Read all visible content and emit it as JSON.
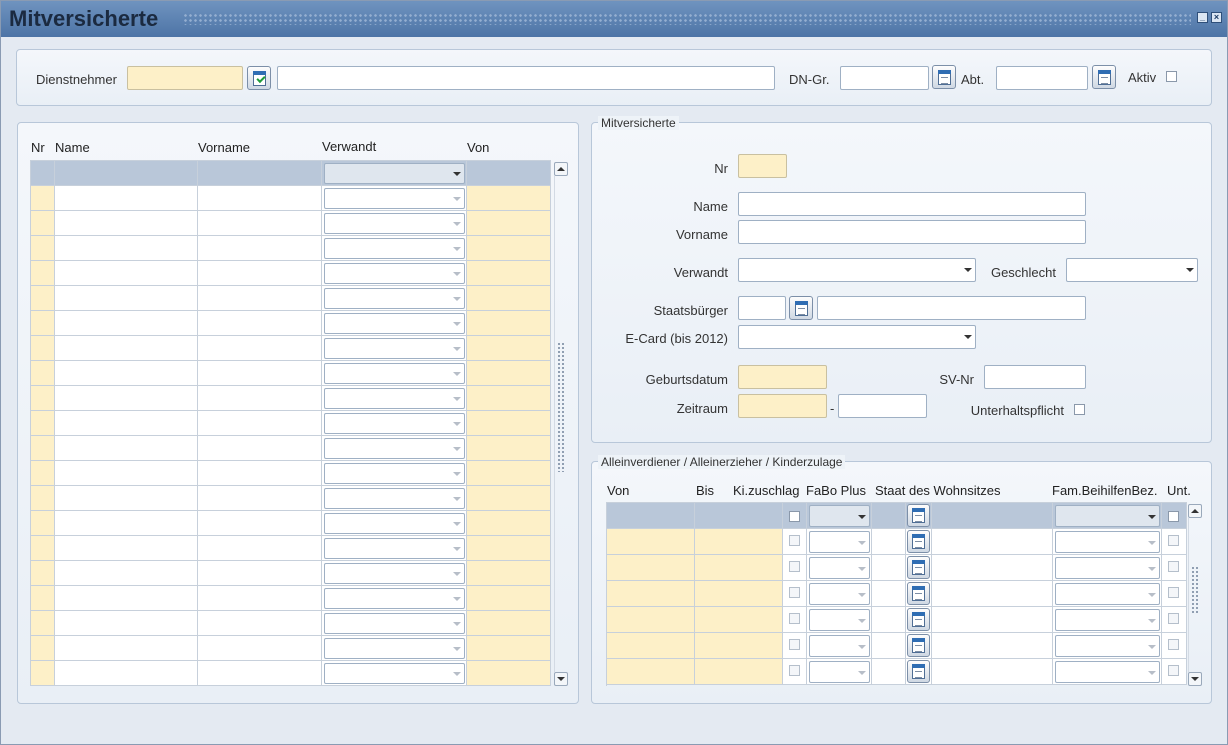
{
  "window": {
    "title": "Mitversicherte"
  },
  "header": {
    "dienstnehmer_label": "Dienstnehmer",
    "dienstnehmer_nr": "",
    "dienstnehmer_name": "",
    "dn_gr_label": "DN-Gr.",
    "dn_gr_value": "",
    "abt_label": "Abt.",
    "abt_value": "",
    "aktiv_label": "Aktiv"
  },
  "list": {
    "columns": [
      "Nr",
      "Name",
      "Vorname",
      "Verwandt",
      "Von"
    ],
    "row_count": 20
  },
  "detail": {
    "legend": "Mitversicherte",
    "nr_label": "Nr",
    "name_label": "Name",
    "vorname_label": "Vorname",
    "verwandt_label": "Verwandt",
    "geschlecht_label": "Geschlecht",
    "staatsbuerger_label": "Staatsbürger",
    "ecard_label": "E-Card (bis 2012)",
    "geburtsdatum_label": "Geburtsdatum",
    "svnr_label": "SV-Nr",
    "zeitraum_label": "Zeitraum",
    "zeitraum_sep": "-",
    "unterhalt_label": "Unterhaltspflicht"
  },
  "allein": {
    "legend": "Alleinverdiener / Alleinerzieher / Kinderzulage",
    "columns": {
      "von": "Von",
      "bis": "Bis",
      "ki": "Ki.zuschlag",
      "fabo": "FaBo Plus",
      "staat": "Staat des Wohnsitzes",
      "fam": "Fam.BeihilfenBez.",
      "unt": "Unt."
    },
    "row_count": 6
  },
  "icons": {
    "lookup": "lookup-doc-icon",
    "lookup_check": "lookup-check-icon",
    "minimize": "minimize-icon",
    "close": "close-icon"
  },
  "colors": {
    "required_field": "#fdf0c8",
    "header_row": "#b9c7d9",
    "title_bar": "#4d74a6"
  }
}
